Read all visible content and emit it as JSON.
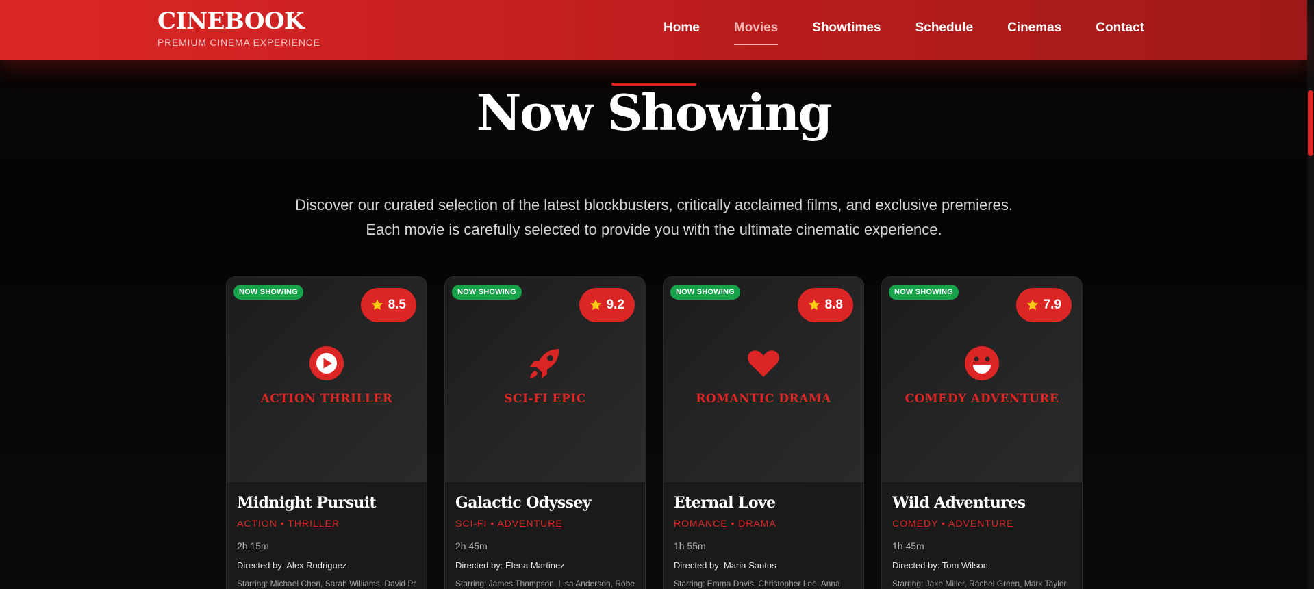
{
  "header": {
    "brand": "CINEBOOK",
    "tagline": "PREMIUM CINEMA EXPERIENCE",
    "nav": [
      {
        "label": "Home",
        "active": false
      },
      {
        "label": "Movies",
        "active": true
      },
      {
        "label": "Showtimes",
        "active": false
      },
      {
        "label": "Schedule",
        "active": false
      },
      {
        "label": "Cinemas",
        "active": false
      },
      {
        "label": "Contact",
        "active": false
      }
    ]
  },
  "hero": {
    "title": "Now Showing",
    "description": "Discover our curated selection of the latest blockbusters, critically acclaimed films, and exclusive premieres. Each movie is carefully selected to provide you with the ultimate cinematic experience."
  },
  "colors": {
    "accent": "#dc2626",
    "badge_green": "#16a34a",
    "star": "#facc15"
  },
  "movies": [
    {
      "badge": "NOW SHOWING",
      "rating": "8.5",
      "icon": "play-circle-icon",
      "genre_label": "ACTION THRILLER",
      "title": "Midnight Pursuit",
      "genres": "ACTION • THRILLER",
      "duration": "2h 15m",
      "director": "Directed by: Alex Rodriguez",
      "starring": "Starring: Michael Chen, Sarah Williams, David Park"
    },
    {
      "badge": "NOW SHOWING",
      "rating": "9.2",
      "icon": "rocket-icon",
      "genre_label": "SCI-FI EPIC",
      "title": "Galactic Odyssey",
      "genres": "SCI-FI • ADVENTURE",
      "duration": "2h 45m",
      "director": "Directed by: Elena Martinez",
      "starring": "Starring: James Thompson, Lisa Anderson, Robert"
    },
    {
      "badge": "NOW SHOWING",
      "rating": "8.8",
      "icon": "heart-icon",
      "genre_label": "ROMANTIC DRAMA",
      "title": "Eternal Love",
      "genres": "ROMANCE • DRAMA",
      "duration": "1h 55m",
      "director": "Directed by: Maria Santos",
      "starring": "Starring: Emma Davis, Christopher Lee, Anna"
    },
    {
      "badge": "NOW SHOWING",
      "rating": "7.9",
      "icon": "smile-icon",
      "genre_label": "COMEDY ADVENTURE",
      "title": "Wild Adventures",
      "genres": "COMEDY • ADVENTURE",
      "duration": "1h 45m",
      "director": "Directed by: Tom Wilson",
      "starring": "Starring: Jake Miller, Rachel Green, Mark Taylor"
    }
  ]
}
